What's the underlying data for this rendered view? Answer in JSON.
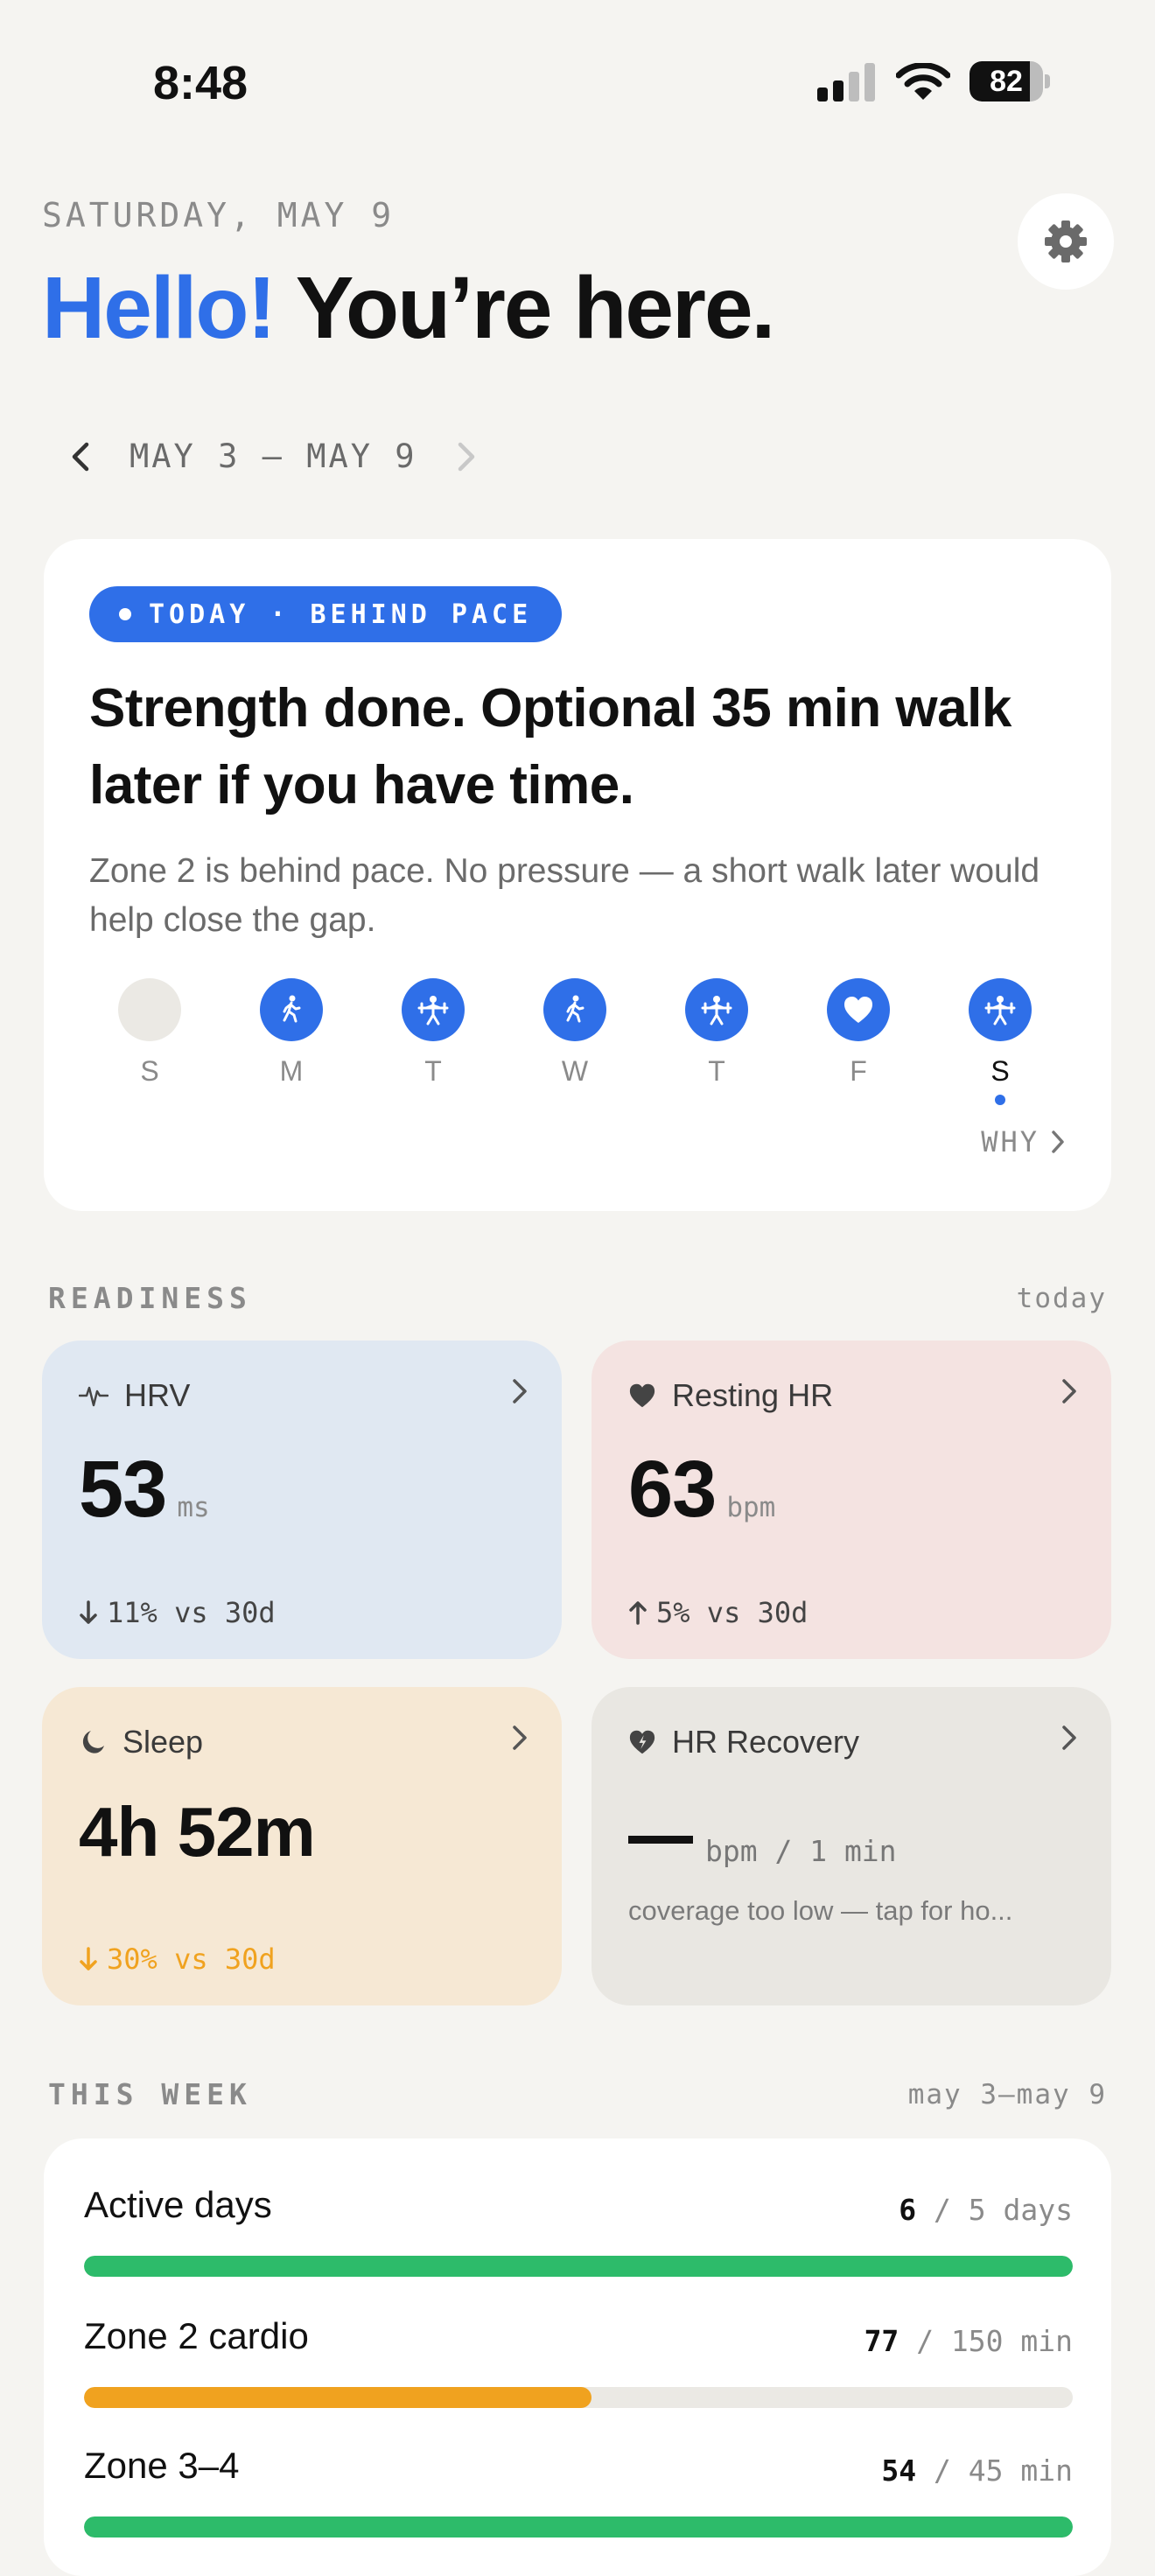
{
  "status": {
    "time": "8:48",
    "battery": "82",
    "battery_level": 0.82
  },
  "header": {
    "date": "SATURDAY, MAY 9",
    "greeting_accent": "Hello!",
    "greeting_rest": "You’re here."
  },
  "range": {
    "label": "MAY 3 — MAY 9"
  },
  "today": {
    "badge": "TODAY · BEHIND PACE",
    "headline": "Strength done. Optional 35 min walk later if you have time.",
    "subtext": "Zone 2 is behind pace. No pressure — a short walk later would help close the gap.",
    "days": [
      {
        "label": "S",
        "icon": "none"
      },
      {
        "label": "M",
        "icon": "walk-icon"
      },
      {
        "label": "T",
        "icon": "strength-icon"
      },
      {
        "label": "W",
        "icon": "walk-icon"
      },
      {
        "label": "T",
        "icon": "strength-icon"
      },
      {
        "label": "F",
        "icon": "heart-icon"
      },
      {
        "label": "S",
        "icon": "strength-icon",
        "current": true
      }
    ],
    "why_label": "WHY"
  },
  "readiness": {
    "title": "READINESS",
    "period": "today",
    "hrv": {
      "title": "HRV",
      "value": "53",
      "unit": "ms",
      "delta": "11% vs 30d",
      "direction": "down"
    },
    "rhr": {
      "title": "Resting HR",
      "value": "63",
      "unit": "bpm",
      "delta": "5% vs 30d",
      "direction": "up"
    },
    "sleep": {
      "title": "Sleep",
      "value": "4h 52m",
      "delta": "30% vs 30d",
      "direction": "down",
      "delta_color": "#f0a21f"
    },
    "hrr": {
      "title": "HR Recovery",
      "unit": "bpm / 1 min",
      "note": "coverage too low — tap for ho..."
    }
  },
  "week": {
    "title": "THIS WEEK",
    "period": "may 3–may 9",
    "goals": [
      {
        "name": "Active days",
        "value": "6",
        "target": "/ 5 days",
        "progress": 1.0,
        "color": "#2dbb6a"
      },
      {
        "name": "Zone 2 cardio",
        "value": "77",
        "target": "/ 150 min",
        "progress": 0.513,
        "color": "#f0a21f"
      },
      {
        "name": "Zone 3–4",
        "value": "54",
        "target": "/ 45 min",
        "progress": 1.0,
        "color": "#2dbb6a"
      }
    ]
  },
  "colors": {
    "accent": "#2f6fe8",
    "good": "#2dbb6a",
    "warning": "#f0a21f"
  }
}
